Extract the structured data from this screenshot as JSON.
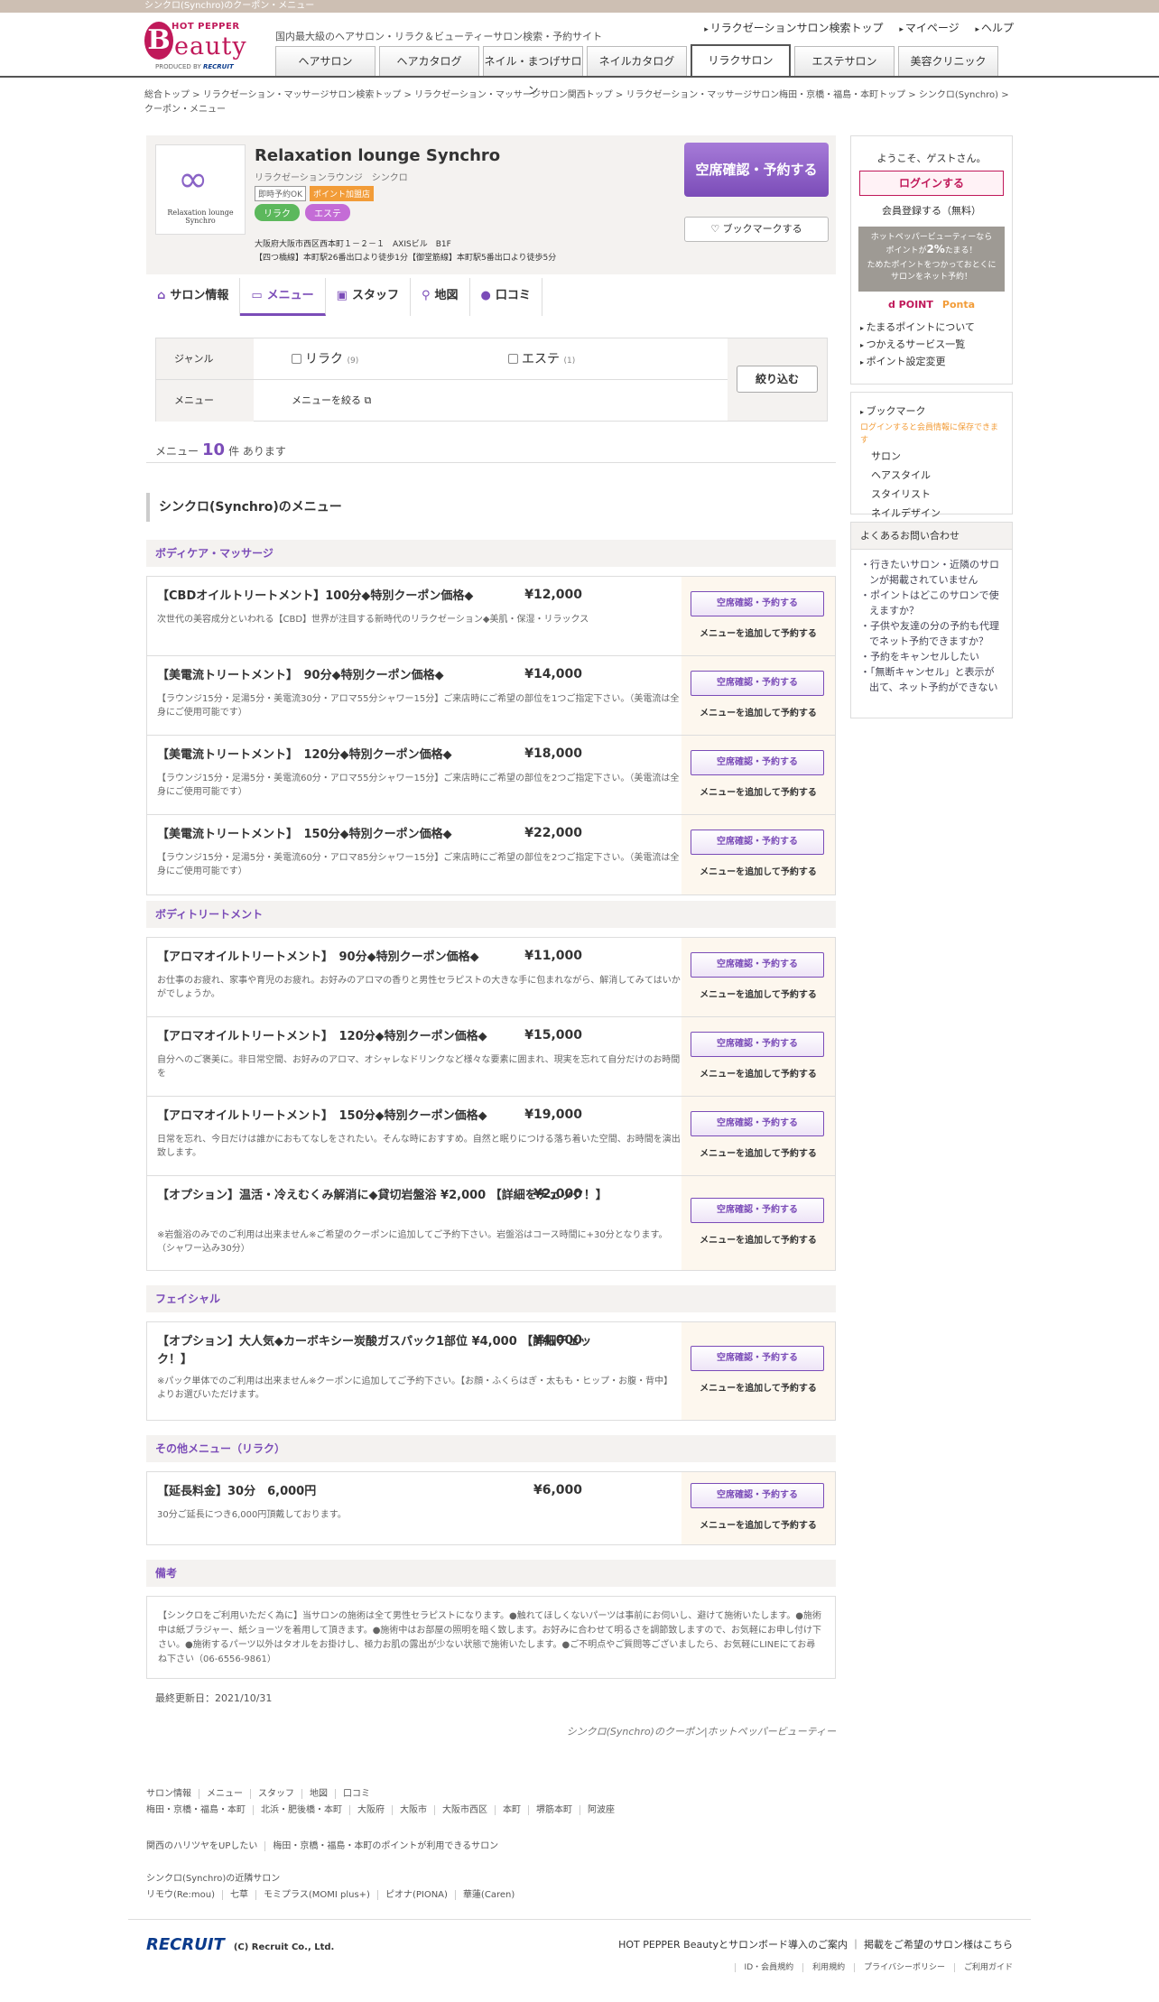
{
  "topbar": "シンクロ(Synchro)のクーポン・メニュー",
  "brand": {
    "hotpepper": "HOT PEPPER",
    "logo_b": "B",
    "logo_rest": "eauty",
    "produced": "PRODUCED BY",
    "recruit": "RECRUIT"
  },
  "tagline": "国内最大級のヘアサロン・リラク＆ビューティーサロン検索・予約サイト",
  "toplinks": [
    "リラクゼーションサロン検索トップ",
    "マイページ",
    "ヘルプ"
  ],
  "tabs": [
    "ヘアサロン",
    "ヘアカタログ",
    "ネイル・まつげサロン",
    "ネイルカタログ",
    "リラクサロン",
    "エステサロン",
    "美容クリニック"
  ],
  "breadcrumb": [
    "総合トップ",
    "リラクゼーション・マッサージサロン検索トップ",
    "リラクゼーション・マッサージサロン関西トップ",
    "リラクゼーション・マッサージサロン梅田・京橋・福島・本町トップ",
    "シンクロ(Synchro)",
    "クーポン・メニュー"
  ],
  "salon": {
    "logo_mark": "∞",
    "logo_text": "Relaxation lounge Synchro",
    "name": "Relaxation lounge Synchro",
    "kana": "リラクゼーションラウンジ　シンクロ",
    "badge1": "即時予約OK",
    "badge2": "ポイント加盟店",
    "cat1": "リラク",
    "cat2": "エステ",
    "address1": "大阪府大阪市西区西本町１－２－１　AXISビル　B1F",
    "address2": "【四つ橋線】本町駅26番出口より徒歩1分【御堂筋線】本町駅5番出口より徒歩5分",
    "reserve": "空席確認・予約する",
    "bookmark": "ブックマークする"
  },
  "subtabs": [
    "サロン情報",
    "メニュー",
    "スタッフ",
    "地図",
    "口コミ"
  ],
  "filter": {
    "genre_label": "ジャンル",
    "opt1": "リラク",
    "opt1_count": "(9)",
    "opt2": "エステ",
    "opt2_count": "(1)",
    "menu_label": "メニュー",
    "menu_link": "メニューを絞る",
    "submit": "絞り込む"
  },
  "count": {
    "pre": "メニュー",
    "num": "10",
    "post": "件 あります"
  },
  "section_title": "シンクロ(Synchro)のメニュー",
  "btn_reserve": "空席確認・予約する",
  "btn_add": "メニューを追加して予約する",
  "groups": [
    {
      "title": "ボディケア・マッサージ",
      "items": [
        {
          "name": "【CBDオイルトリートメント】100分◆特別クーポン価格◆",
          "price": "¥12,000",
          "desc": "次世代の美容成分といわれる【CBD】世界が注目する新時代のリラクゼーション◆美肌・保湿・リラックス"
        },
        {
          "name": "【美電流トリートメント】　90分◆特別クーポン価格◆",
          "price": "¥14,000",
          "desc": "【ラウンジ15分・足湯5分・美電流30分・アロマ55分シャワー15分】ご来店時にご希望の部位を1つご指定下さい。（美電流は全身にご使用可能です）"
        },
        {
          "name": "【美電流トリートメント】　120分◆特別クーポン価格◆",
          "price": "¥18,000",
          "desc": "【ラウンジ15分・足湯5分・美電流60分・アロマ55分シャワー15分】ご来店時にご希望の部位を2つご指定下さい。（美電流は全身にご使用可能です）"
        },
        {
          "name": "【美電流トリートメント】　150分◆特別クーポン価格◆",
          "price": "¥22,000",
          "desc": "【ラウンジ15分・足湯5分・美電流60分・アロマ85分シャワー15分】ご来店時にご希望の部位を2つご指定下さい。（美電流は全身にご使用可能です）"
        }
      ]
    },
    {
      "title": "ボディトリートメント",
      "items": [
        {
          "name": "【アロマオイルトリートメント】　90分◆特別クーポン価格◆",
          "price": "¥11,000",
          "desc": "お仕事のお疲れ、家事や育児のお疲れ。お好みのアロマの香りと男性セラピストの大きな手に包まれながら、解消してみてはいかがでしょうか。"
        },
        {
          "name": "【アロマオイルトリートメント】　120分◆特別クーポン価格◆",
          "price": "¥15,000",
          "desc": "自分へのご褒美に。非日常空間、お好みのアロマ、オシャレなドリンクなど様々な要素に囲まれ、現実を忘れて自分だけのお時間を"
        },
        {
          "name": "【アロマオイルトリートメント】　150分◆特別クーポン価格◆",
          "price": "¥19,000",
          "desc": "日常を忘れ、今日だけは誰かにおもてなしをされたい。そんな時におすすめ。自然と眠りにつける落ち着いた空間、お時間を演出致します。"
        },
        {
          "name": "【オプション】温活・冷えむくみ解消に◆貸切岩盤浴 ¥2,000 【詳細をチェック！】",
          "price": "¥2,000",
          "desc": "※岩盤浴のみでのご利用は出来ません※ご希望のクーポンに追加してご予約下さい。岩盤浴はコース時間に+30分となります。（シャワー込み30分）"
        }
      ]
    },
    {
      "title": "フェイシャル",
      "items": [
        {
          "name": "【オプション】大人気◆カーボキシー炭酸ガスパック1部位 ¥4,000 【詳細チェック！】",
          "price": "¥4,000",
          "desc": "※パック単体でのご利用は出来ません※クーポンに追加してご予約下さい。【お顔・ふくらはぎ・太もも・ヒップ・お腹・背中】よりお選びいただけます。"
        }
      ]
    },
    {
      "title": "その他メニュー（リラク）",
      "items": [
        {
          "name": "【延長料金】30分　6,000円",
          "price": "¥6,000",
          "desc": "30分ご延長につき6,000円頂戴しております。"
        }
      ]
    }
  ],
  "note": {
    "title": "備考",
    "text": "【シンクロをご利用いただく為に】当サロンの施術は全て男性セラピストになります。●触れてほしくないパーツは事前にお伺いし、避けて施術いたします。●施術中は紙ブラジャー、紙ショーツを着用して頂きます。●施術中はお部屋の照明を暗く致します。お好みに合わせて明るさを調節致しますので、お気軽にお申し付け下さい。●施術するパーツ以外はタオルをお掛けし、極力お肌の露出が少ない状態で施術いたします。●ご不明点やご質問等ございましたら、お気軽にLINEにてお尋ね下さい（06-6556-9861）"
  },
  "updated": "最終更新日：2021/10/31",
  "footer_tagline": "シンクロ(Synchro)のクーポン|ホットペッパービューティー",
  "sidebar": {
    "welcome": "ようこそ、ゲストさん。",
    "login": "ログインする",
    "register": "会員登録する（無料）",
    "point1": "ホットペッパービューティーなら",
    "point2": "ポイントが",
    "point_pct": "2%",
    "point3": "たまる！",
    "point4": "ためたポイントをつかっておとくにサロンをネット予約！",
    "dpoint": "d POINT",
    "ponta": "Ponta",
    "links": [
      "たまるポイントについて",
      "つかえるサービス一覧",
      "ポイント設定変更"
    ],
    "bm_title": "ブックマーク",
    "bm_warn": "ログインすると会員情報に保存できます",
    "bm_items": [
      "サロン",
      "ヘアスタイル",
      "スタイリスト",
      "ネイルデザイン"
    ],
    "faq_title": "よくあるお問い合わせ",
    "faq": [
      "行きたいサロン・近隣のサロンが掲載されていません",
      "ポイントはどこのサロンで使えますか？",
      "子供や友達の分の予約も代理でネット予約できますか？",
      "予約をキャンセルしたい",
      "「無断キャンセル」と表示が出て、ネット予約ができない"
    ]
  },
  "footer_links1": [
    "サロン情報",
    "メニュー",
    "スタッフ",
    "地図",
    "口コミ"
  ],
  "footer_links2": [
    "梅田・京橋・福島・本町",
    "北浜・肥後橋・本町",
    "大阪府",
    "大阪市",
    "大阪市西区",
    "本町",
    "堺筋本町",
    "阿波座"
  ],
  "footer_links3": [
    "関西のハリツヤをUPしたい",
    "梅田・京橋・福島・本町のポイントが利用できるサロン"
  ],
  "nearby_title": "シンクロ(Synchro)の近隣サロン",
  "nearby": [
    "リモウ(Re:mou)",
    "七草",
    "モミプラス(MOMI plus+)",
    "ピオナ(PIONA)",
    "華蓮(Caren)"
  ],
  "footer": {
    "recruit": "RECRUIT",
    "copy": "(C) Recruit Co., Ltd.",
    "r1a": "HOT PEPPER Beautyとサロンボード導入のご案内",
    "r1b": "掲載をご希望のサロン様はこちら",
    "r2": [
      "ID・会員規約",
      "利用規約",
      "プライバシーポリシー",
      "ご利用ガイド"
    ]
  },
  "colors": {
    "accent": "#7b4cb8",
    "brand": "#c0195a",
    "relax": "#5cb85c",
    "este": "#c46cd6"
  }
}
